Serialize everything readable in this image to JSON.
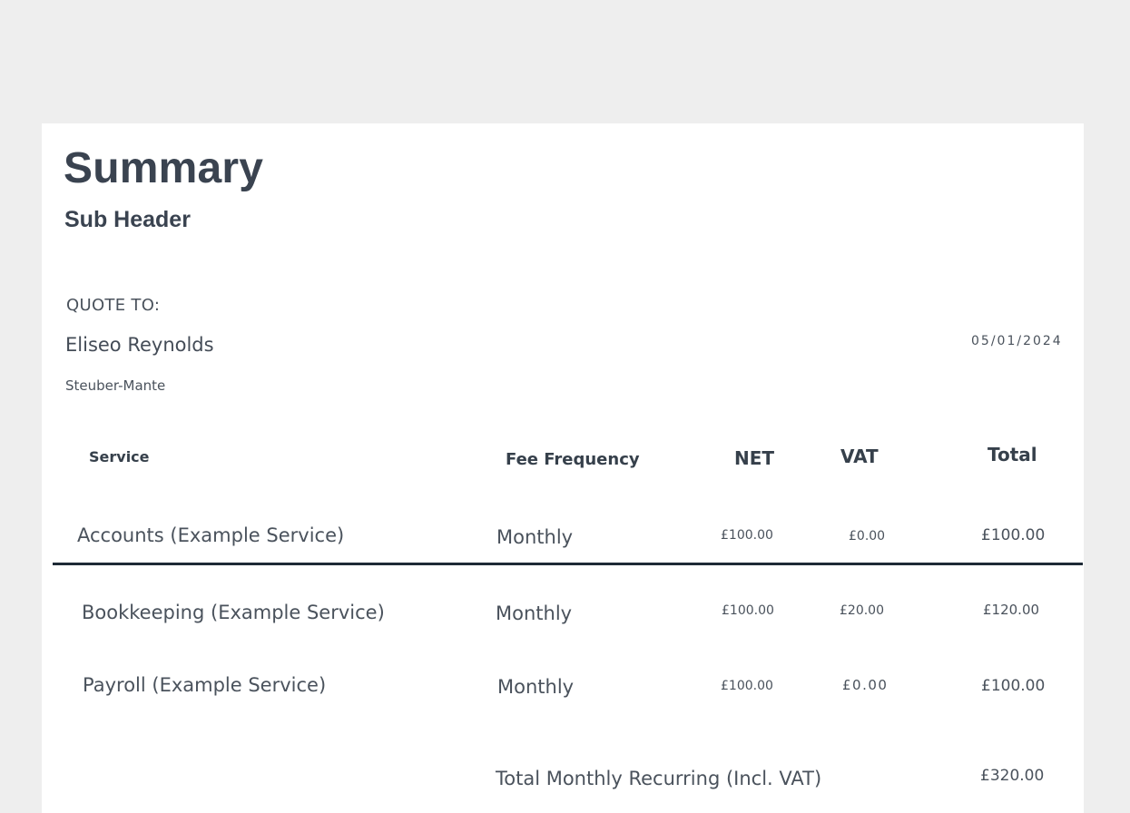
{
  "header": {
    "title": "Summary",
    "subheader": "Sub Header"
  },
  "quote": {
    "label": "QUOTE TO:",
    "client_name": "Eliseo Reynolds",
    "company": "Steuber-Mante",
    "date": "05/01/2024"
  },
  "table": {
    "columns": [
      "Service",
      "Fee Frequency",
      "NET",
      "VAT",
      "Total"
    ],
    "rows": [
      {
        "service": "Accounts (Example Service)",
        "frequency": "Monthly",
        "net": "£100.00",
        "vat": "£0.00",
        "total": "£100.00"
      },
      {
        "service": "Bookkeeping (Example Service)",
        "frequency": "Monthly",
        "net": "£100.00",
        "vat": "£20.00",
        "total": "£120.00"
      },
      {
        "service": "Payroll (Example Service)",
        "frequency": "Monthly",
        "net": "£100.00",
        "vat": "£0.00",
        "total": "£100.00"
      }
    ]
  },
  "summary": {
    "label": "Total Monthly Recurring (Incl. VAT)",
    "value": "£320.00"
  },
  "colors": {
    "background": "#eeeeee",
    "page": "#ffffff",
    "text": "#3d4651",
    "divider": "#1e2a36"
  }
}
